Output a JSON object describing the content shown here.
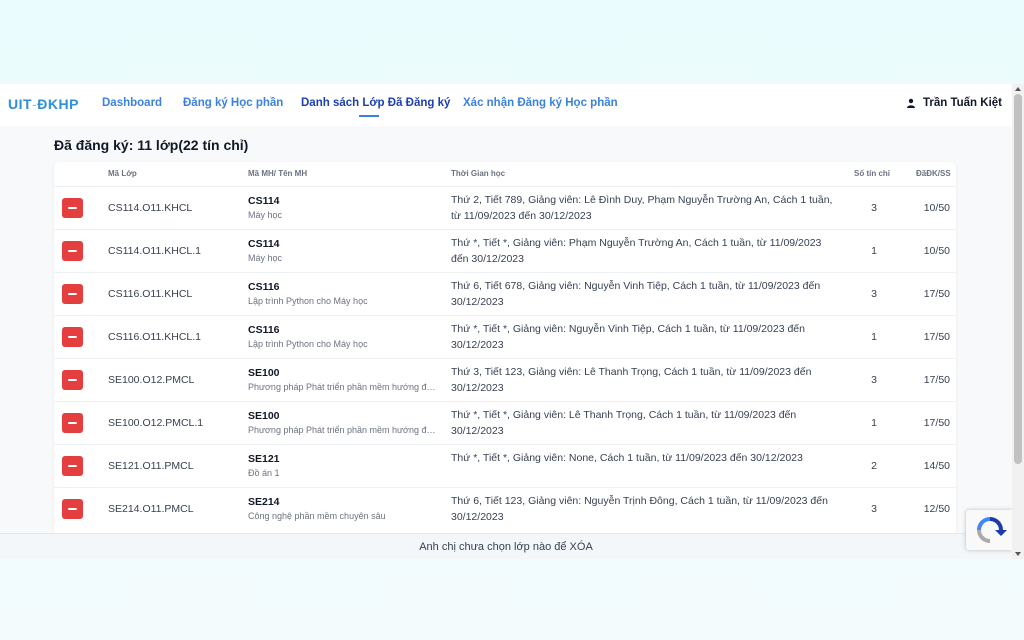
{
  "brand": {
    "main": "UIT",
    "sep": "-",
    "sub": "ĐKHP"
  },
  "nav": {
    "dashboard": "Dashboard",
    "register": "Đăng ký Học phần",
    "registered_list": "Danh sách Lớp Đã Đăng ký",
    "confirm": "Xác nhận Đăng ký Học phần"
  },
  "user": {
    "name": "Trần Tuấn Kiệt",
    "icon": "user-icon"
  },
  "summary": "Đã đăng ký: 11 lớp(22 tín chỉ)",
  "table": {
    "headers": {
      "class_code": "Mã Lớp",
      "subject": "Mã MH/ Tên MH",
      "schedule": "Thời Gian học",
      "credits": "Số tín chỉ",
      "registered": "ĐãĐK/SS"
    },
    "rows": [
      {
        "code": "CS114.O11.KHCL",
        "subject_id": "CS114",
        "subject_name": "Máy học",
        "schedule": "Thứ 2, Tiết 789, Giảng viên: Lê Đình Duy, Phạm Nguyễn Trường An, Cách 1 tuần, từ 11/09/2023 đến 30/12/2023",
        "credits": "3",
        "registered": "10/50"
      },
      {
        "code": "CS114.O11.KHCL.1",
        "subject_id": "CS114",
        "subject_name": "Máy học",
        "schedule": "Thứ *, Tiết *, Giảng viên: Phạm Nguyễn Trường An, Cách 1 tuần, từ 11/09/2023 đến 30/12/2023",
        "credits": "1",
        "registered": "10/50"
      },
      {
        "code": "CS116.O11.KHCL",
        "subject_id": "CS116",
        "subject_name": "Lập trình Python cho Máy học",
        "schedule": "Thứ 6, Tiết 678, Giảng viên: Nguyễn Vinh Tiệp, Cách 1 tuần, từ 11/09/2023 đến 30/12/2023",
        "credits": "3",
        "registered": "17/50"
      },
      {
        "code": "CS116.O11.KHCL.1",
        "subject_id": "CS116",
        "subject_name": "Lập trình Python cho Máy học",
        "schedule": "Thứ *, Tiết *, Giảng viên: Nguyễn Vinh Tiệp, Cách 1 tuần, từ 11/09/2023 đến 30/12/2023",
        "credits": "1",
        "registered": "17/50"
      },
      {
        "code": "SE100.O12.PMCL",
        "subject_id": "SE100",
        "subject_name": "Phương pháp Phát triển phần mềm hướng đối tượng",
        "schedule": "Thứ 3, Tiết 123, Giảng viên: Lê Thanh Trọng, Cách 1 tuần, từ 11/09/2023 đến 30/12/2023",
        "credits": "3",
        "registered": "17/50"
      },
      {
        "code": "SE100.O12.PMCL.1",
        "subject_id": "SE100",
        "subject_name": "Phương pháp Phát triển phần mềm hướng đối tượng",
        "schedule": "Thứ *, Tiết *, Giảng viên: Lê Thanh Trọng, Cách 1 tuần, từ 11/09/2023 đến 30/12/2023",
        "credits": "1",
        "registered": "17/50"
      },
      {
        "code": "SE121.O11.PMCL",
        "subject_id": "SE121",
        "subject_name": "Đồ án 1",
        "schedule": "Thứ *, Tiết *, Giảng viên: None, Cách 1 tuần, từ 11/09/2023 đến 30/12/2023",
        "credits": "2",
        "registered": "14/50"
      },
      {
        "code": "SE214.O11.PMCL",
        "subject_id": "SE214",
        "subject_name": "Công nghệ phần mềm chuyên sâu",
        "schedule": "Thứ 6, Tiết 123, Giảng viên: Nguyễn Trịnh Đông, Cách 1 tuần, từ 11/09/2023 đến 30/12/2023",
        "credits": "3",
        "registered": "12/50"
      }
    ]
  },
  "footer": "Anh chị chưa chọn lớp nào để XÓA",
  "colors": {
    "accent": "#3b82e0",
    "danger": "#e53e3e"
  }
}
